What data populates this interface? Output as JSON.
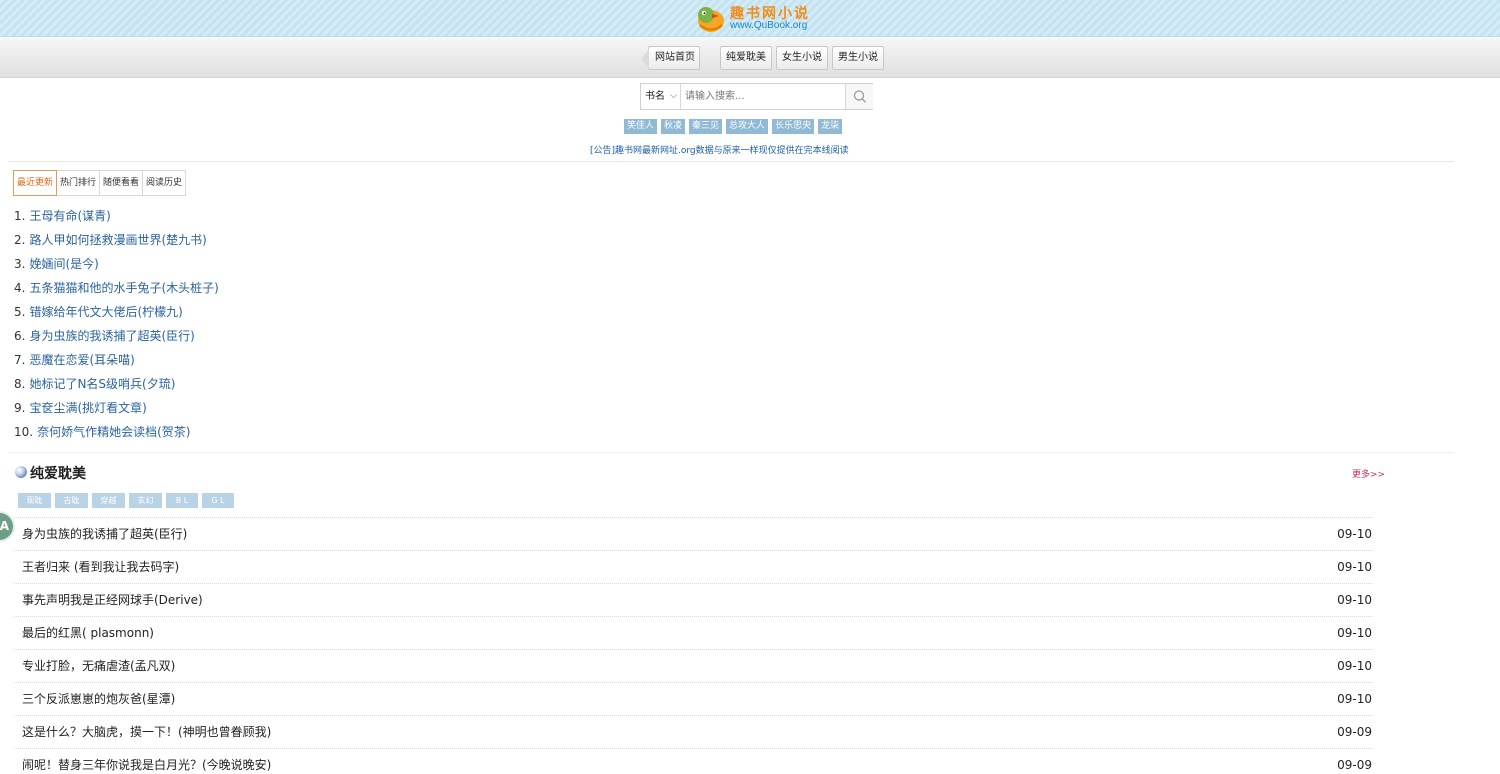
{
  "logo": {
    "title": "趣书网小说",
    "url": "www.QuBook.org",
    "mascot_icon": "cartoon-bird-icon"
  },
  "nav": {
    "items": [
      {
        "label": "网站首页"
      },
      {
        "label": "纯爱耽美"
      },
      {
        "label": "女生小说"
      },
      {
        "label": "男生小说"
      }
    ]
  },
  "search": {
    "type_label": "书名",
    "placeholder": "请输入搜索...",
    "value": "",
    "button_icon": "search-icon"
  },
  "hot_tags": [
    "笑佳人",
    "秋凌",
    "秦三见",
    "总攻大人",
    "长乐思央",
    "龙柒"
  ],
  "notice": "[公告]趣书网最新网址.org数据与原来一样现仅提供在完本线阅读",
  "tabs": [
    {
      "label": "最近更新",
      "active": true
    },
    {
      "label": "热门排行",
      "active": false
    },
    {
      "label": "随便看看",
      "active": false
    },
    {
      "label": "阅读历史",
      "active": false
    }
  ],
  "recent_list": [
    {
      "num": "1.",
      "title": "王母有命(谋青)"
    },
    {
      "num": "2.",
      "title": "路人甲如何拯救漫画世界(楚九书)"
    },
    {
      "num": "3.",
      "title": "娩婳间(是今)"
    },
    {
      "num": "4.",
      "title": "五条猫猫和他的水手兔子(木头桩子)"
    },
    {
      "num": "5.",
      "title": "错嫁给年代文大佬后(柠檬九)"
    },
    {
      "num": "6.",
      "title": "身为虫族的我诱捕了超英(臣行)"
    },
    {
      "num": "7.",
      "title": "恶魔在恋爱(耳朵喵)"
    },
    {
      "num": "8.",
      "title": "她标记了N名S级哨兵(夕琉)"
    },
    {
      "num": "9.",
      "title": "宝奁尘满(挑灯看文章)"
    },
    {
      "num": "10.",
      "title": "奈何娇气作精她会读档(贺茶)"
    }
  ],
  "section": {
    "title": "纯爱耽美",
    "more": "更多>>",
    "icon": "globe-icon",
    "sub_tags": [
      "现耽",
      "古耽",
      "穿越",
      "玄幻",
      "B L",
      "G L"
    ],
    "books": [
      {
        "title": "身为虫族的我诱捕了超英(臣行)",
        "date": "09-10"
      },
      {
        "title": "王者归来 (看到我让我去码字)",
        "date": "09-10"
      },
      {
        "title": "事先声明我是正经网球手(Derive)",
        "date": "09-10"
      },
      {
        "title": "最后的红黑( plasmonn)",
        "date": "09-10"
      },
      {
        "title": "专业打脸，无痛虐渣(孟凡双)",
        "date": "09-10"
      },
      {
        "title": "三个反派崽崽的炮灰爸(星潭)",
        "date": "09-10"
      },
      {
        "title": "这是什么？大脑虎，摸一下！(神明也曾眷顾我)",
        "date": "09-09"
      },
      {
        "title": "闹呢！替身三年你说我是白月光？(今晚说晚安)",
        "date": "09-09"
      }
    ]
  },
  "float_badge": {
    "label": "A"
  }
}
